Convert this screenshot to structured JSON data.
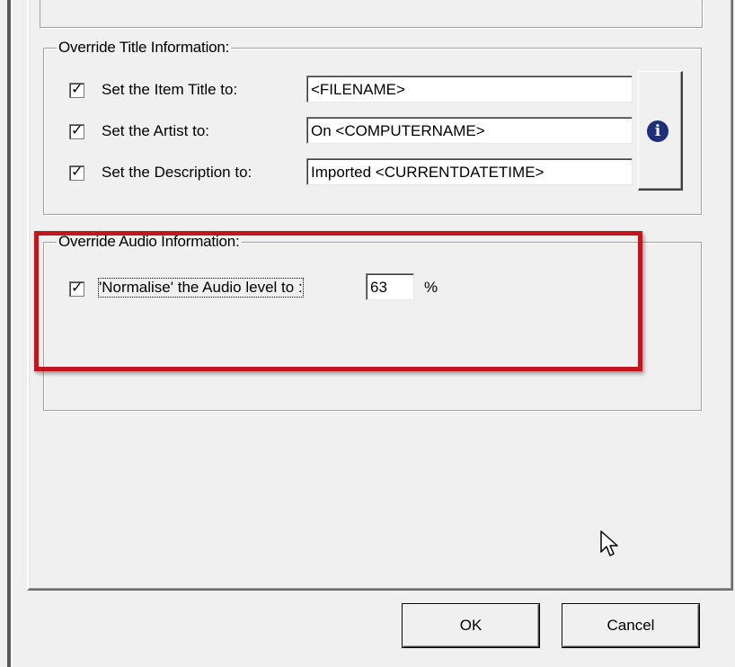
{
  "title_group": {
    "title": "Override Title Information:",
    "rows": [
      {
        "label": "Set the Item Title to:",
        "value": "<FILENAME>",
        "checked": true
      },
      {
        "label": "Set the Artist to:",
        "value": "On <COMPUTERNAME>",
        "checked": true
      },
      {
        "label": "Set the Description to:",
        "value": "Imported <CURRENTDATETIME>",
        "checked": true
      }
    ],
    "info_icon": "info-icon"
  },
  "audio_group": {
    "title": "Override Audio Information:",
    "normalise_label": "'Normalise' the Audio level to :",
    "normalise_checked": true,
    "level_value": "63",
    "unit": "%"
  },
  "buttons": {
    "ok": "OK",
    "cancel": "Cancel"
  },
  "colors": {
    "highlight": "#c0161c",
    "info_icon": "#1d2f7a",
    "background": "#f0f0f0"
  }
}
